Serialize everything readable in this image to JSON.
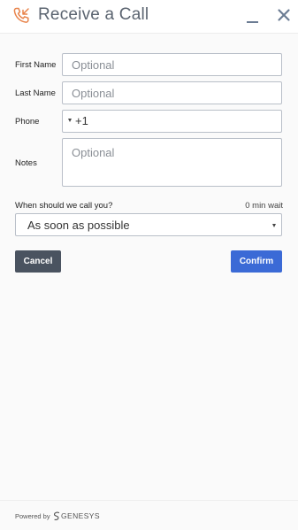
{
  "header": {
    "title": "Receive a Call",
    "icon": "phone-incoming-icon",
    "accent_color": "#e8834a"
  },
  "form": {
    "first_name": {
      "label": "First Name",
      "placeholder": "Optional",
      "value": ""
    },
    "last_name": {
      "label": "Last Name",
      "placeholder": "Optional",
      "value": ""
    },
    "phone": {
      "label": "Phone",
      "dial_code": "+1",
      "value": ""
    },
    "notes": {
      "label": "Notes",
      "placeholder": "Optional",
      "value": ""
    },
    "schedule": {
      "label": "When should we call you?",
      "wait": "0 min wait",
      "selected": "As soon as possible"
    }
  },
  "actions": {
    "cancel_label": "Cancel",
    "confirm_label": "Confirm",
    "cancel_color": "#4a5360",
    "confirm_color": "#3b6ad6"
  },
  "footer": {
    "powered_by": "Powered by",
    "brand": "GENESYS"
  }
}
